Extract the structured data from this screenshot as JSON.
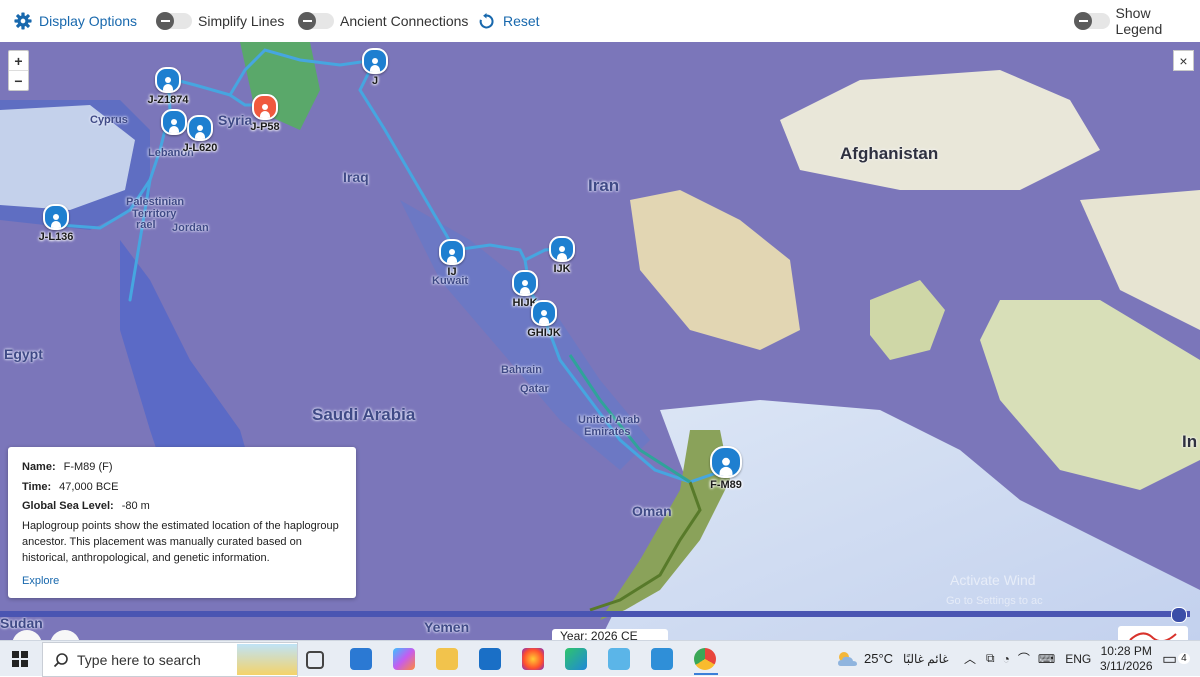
{
  "toolbar": {
    "display_options": "Display Options",
    "simplify_lines": "Simplify Lines",
    "ancient_connections": "Ancient Connections",
    "reset": "Reset",
    "show_legend": "Show Legend",
    "accent_color": "#1868ad"
  },
  "map": {
    "zoom_in": "+",
    "zoom_out": "−",
    "close": "×",
    "labels": {
      "cyprus": "Cyprus",
      "lebanon": "Lebanon",
      "syria": "Syria",
      "palestinian": "Palestinian",
      "territory": "Territory",
      "israel": "rael",
      "jordan": "Jordan",
      "iraq": "Iraq",
      "iran": "Iran",
      "afghanistan": "Afghanistan",
      "kuwait": "Kuwait",
      "bahrain": "Bahrain",
      "qatar": "Qatar",
      "uae1": "United Arab",
      "uae2": "Emirates",
      "saudi": "Saudi Arabia",
      "egypt": "Egypt",
      "oman": "Oman",
      "yemen": "Yemen",
      "sudan": "Sudan",
      "india_partial": "In",
      "watermark1": "Activate Wind",
      "watermark2": "Go to Settings to ac"
    },
    "haplogroups": [
      {
        "id": "J-Z1874",
        "color": "#1e7fd0"
      },
      {
        "id": "J-P58",
        "color": "#f0593e"
      },
      {
        "id": "J-L620",
        "color": "#1e7fd0"
      },
      {
        "id": "J-L136",
        "color": "#1e7fd0"
      },
      {
        "id": "J",
        "color": "#1e7fd0"
      },
      {
        "id": "IJ",
        "color": "#1e7fd0"
      },
      {
        "id": "IJK",
        "color": "#1e7fd0"
      },
      {
        "id": "HIJK",
        "color": "#1e7fd0"
      },
      {
        "id": "GHIJK",
        "color": "#1e7fd0"
      },
      {
        "id": "F-M89",
        "color": "#1e7fd0"
      }
    ]
  },
  "info": {
    "name_label": "Name:",
    "name_value": "F-M89 (F)",
    "time_label": "Time:",
    "time_value": "47,000 BCE",
    "sea_label": "Global Sea Level:",
    "sea_value": "-80 m",
    "description": "Haplogroup points show the estimated location of the haplogroup ancestor. This placement was manually curated based on historical, anthropological, and genetic information.",
    "explore": "Explore"
  },
  "timeline": {
    "progress": 0.99,
    "year_text": "Year: 2026 CE"
  },
  "taskbar": {
    "search_placeholder": "Type here to search",
    "weather": "25°C",
    "weather_text": "غائم غالبًا",
    "language": "ENG",
    "time": "10:28 PM",
    "date": "3/11/2026",
    "notifications": "4"
  }
}
